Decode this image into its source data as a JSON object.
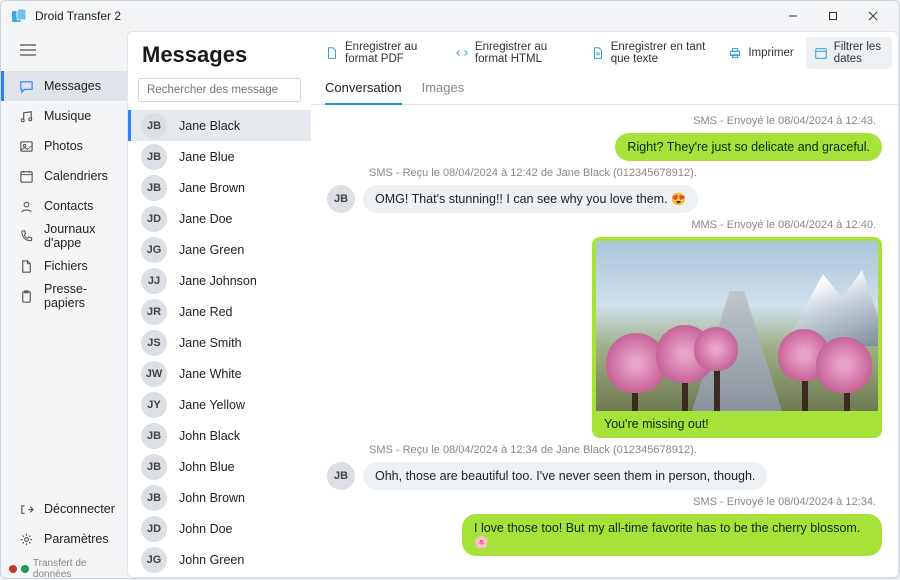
{
  "app": {
    "title": "Droid Transfer 2"
  },
  "sidebar": {
    "items": [
      {
        "label": "Messages"
      },
      {
        "label": "Musique"
      },
      {
        "label": "Photos"
      },
      {
        "label": "Calendriers"
      },
      {
        "label": "Contacts"
      },
      {
        "label": "Journaux d'appe"
      },
      {
        "label": "Fichiers"
      },
      {
        "label": "Presse-papiers"
      }
    ],
    "bottom": [
      {
        "label": "Déconnecter"
      },
      {
        "label": "Paramètres"
      }
    ],
    "status": "Transfert de données"
  },
  "col2": {
    "title": "Messages",
    "search_placeholder": "Rechercher des message",
    "contacts": [
      {
        "initials": "JB",
        "name": "Jane Black"
      },
      {
        "initials": "JB",
        "name": "Jane Blue"
      },
      {
        "initials": "JB",
        "name": "Jane Brown"
      },
      {
        "initials": "JD",
        "name": "Jane Doe"
      },
      {
        "initials": "JG",
        "name": "Jane Green"
      },
      {
        "initials": "JJ",
        "name": "Jane Johnson"
      },
      {
        "initials": "JR",
        "name": "Jane Red"
      },
      {
        "initials": "JS",
        "name": "Jane Smith"
      },
      {
        "initials": "JW",
        "name": "Jane White"
      },
      {
        "initials": "JY",
        "name": "Jane Yellow"
      },
      {
        "initials": "JB",
        "name": "John Black"
      },
      {
        "initials": "JB",
        "name": "John Blue"
      },
      {
        "initials": "JB",
        "name": "John Brown"
      },
      {
        "initials": "JD",
        "name": "John Doe"
      },
      {
        "initials": "JG",
        "name": "John Green"
      }
    ]
  },
  "toolbar": {
    "pdf": "Enregistrer au format PDF",
    "html": "Enregistrer au format HTML",
    "txt": "Enregistrer en tant que texte",
    "print": "Imprimer",
    "filter": "Filtrer les dates"
  },
  "tabs": {
    "conversation": "Conversation",
    "images": "Images"
  },
  "conv": {
    "m1_meta": "SMS - Envoyé le 08/04/2024 à 12:43.",
    "m1_text": "Right? They're just so delicate and graceful.",
    "m2_meta": "SMS - Reçu le 08/04/2024 à 12:42 de Jane Black (012345678912).",
    "m2_av": "JB",
    "m2_text": "OMG! That's stunning!! I can see why you love them. ",
    "m3_meta": "MMS - Envoyé le 08/04/2024 à 12:40.",
    "m3_text": "You're missing out!",
    "m4_meta": "SMS - Reçu le 08/04/2024 à 12:34 de Jane Black (012345678912).",
    "m4_av": "JB",
    "m4_text": "Ohh, those are beautiful too. I've never seen them in person, though.",
    "m5_meta": "SMS - Envoyé le 08/04/2024 à 12:34.",
    "m5_text": "I love those too! But my all-time favorite has to be the cherry blossom. "
  }
}
